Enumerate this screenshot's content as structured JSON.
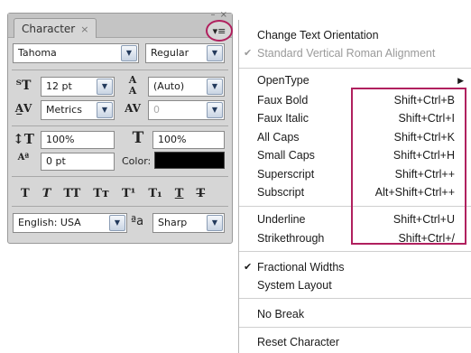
{
  "panel": {
    "tab_title": "Character",
    "tab_close": "×",
    "window_buttons": "– ×",
    "menu_button": "▾≡",
    "font_family": "Tahoma",
    "font_style": "Regular",
    "font_size": "12 pt",
    "leading": "(Auto)",
    "kerning": "Metrics",
    "tracking": "0",
    "vertical_scale": "100%",
    "horizontal_scale": "100%",
    "baseline_shift": "0 pt",
    "color_label": "Color:",
    "color_value": "#000000",
    "language": "English: USA",
    "antialias": "Sharp",
    "antialias_prefix": "ªa"
  },
  "menu": {
    "items": [
      {
        "label": "Change Text Orientation",
        "shortcut": "",
        "checked": false,
        "disabled": false
      },
      {
        "label": "Standard Vertical Roman Alignment",
        "shortcut": "",
        "checked": true,
        "disabled": true
      },
      {
        "label": "OpenType",
        "shortcut": "",
        "submenu": true
      },
      {
        "label": "Faux Bold",
        "shortcut": "Shift+Ctrl+B"
      },
      {
        "label": "Faux Italic",
        "shortcut": "Shift+Ctrl+I"
      },
      {
        "label": "All Caps",
        "shortcut": "Shift+Ctrl+K"
      },
      {
        "label": "Small Caps",
        "shortcut": "Shift+Ctrl+H"
      },
      {
        "label": "Superscript",
        "shortcut": "Shift+Ctrl++"
      },
      {
        "label": "Subscript",
        "shortcut": "Alt+Shift+Ctrl++"
      },
      {
        "label": "Underline",
        "shortcut": "Shift+Ctrl+U"
      },
      {
        "label": "Strikethrough",
        "shortcut": "Shift+Ctrl+/"
      },
      {
        "label": "Fractional Widths",
        "shortcut": "",
        "checked": true
      },
      {
        "label": "System Layout",
        "shortcut": ""
      },
      {
        "label": "No Break",
        "shortcut": ""
      },
      {
        "label": "Reset Character",
        "shortcut": ""
      }
    ]
  },
  "colors": {
    "highlight": "#b0205e",
    "panel_bg": "#d6d6d6"
  }
}
